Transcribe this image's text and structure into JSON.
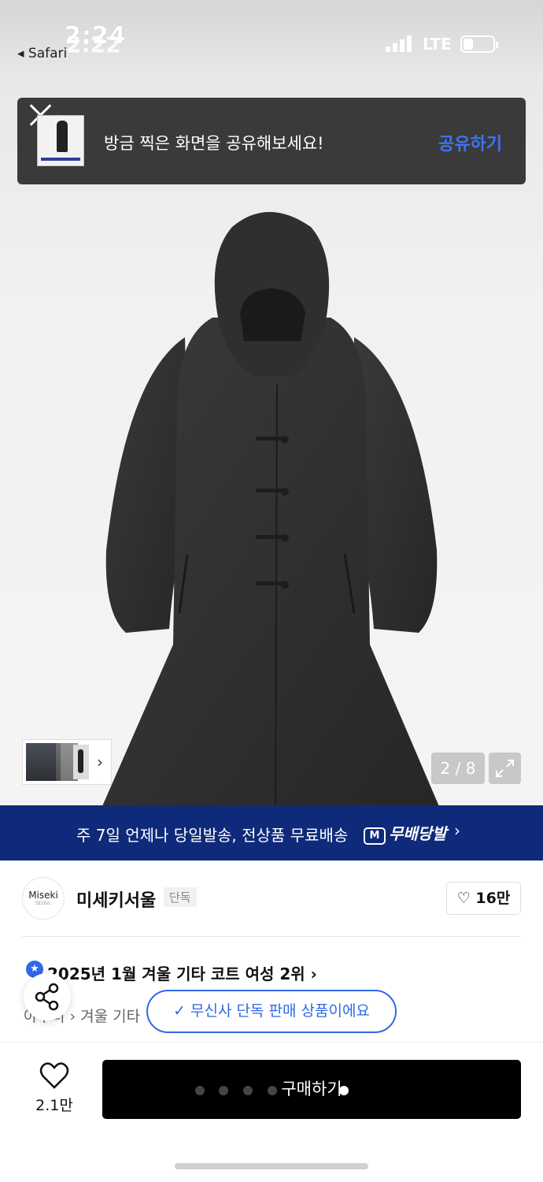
{
  "status_bar": {
    "time": "2:24",
    "time_overlay": "2:22",
    "back_app": "◂ Safari",
    "network": "LTE"
  },
  "share_banner": {
    "message": "방금 찍은 화면을 공유해보세요!",
    "action": "공유하기"
  },
  "gallery": {
    "counter": "2 / 8"
  },
  "delivery": {
    "text": "주 7일 언제나 당일발송, 전상품 무료배송",
    "badge_mark": "M",
    "badge": "무배당발",
    "chevron": "›"
  },
  "brand": {
    "logo_text": "Miseki",
    "logo_sub": "SEOUL",
    "name": "미세키서울",
    "tag": "단독",
    "likes": "16만"
  },
  "ranking": {
    "text": "2025년 1월 겨울 기타 코트 여성 2위 ›",
    "category": "아우터 › 겨울 기타"
  },
  "toast": {
    "message": "✓ 무신사 단독 판매 상품이에요"
  },
  "bottom_bar": {
    "wish_count": "2.1만",
    "buy_label": "구매하기"
  },
  "colors": {
    "accent_blue": "#2f69e8",
    "delivery_navy": "#0f2a7a",
    "banner_dark": "#3a3a3a",
    "buy_black": "#000000"
  }
}
